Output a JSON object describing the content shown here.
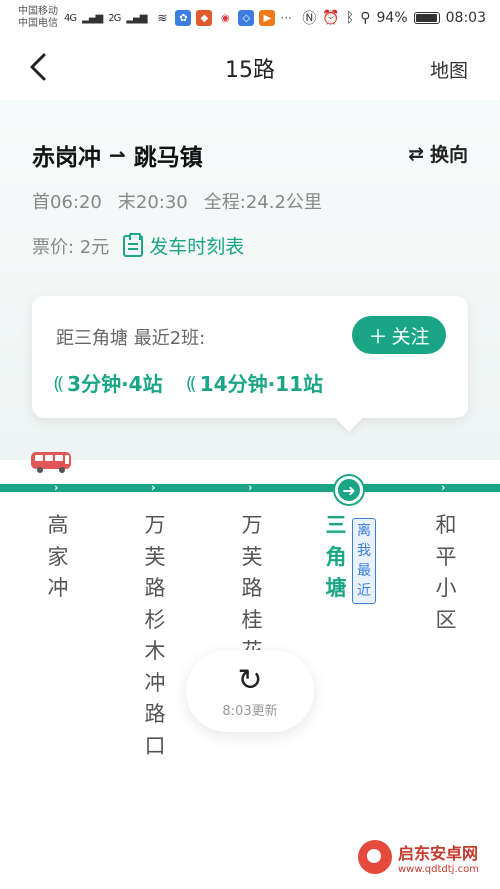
{
  "status_bar": {
    "carrier_1": "中国移动",
    "carrier_2": "中国电信",
    "signal_1": "4G",
    "signal_2": "2G",
    "battery_percent": "94%",
    "time": "08:03"
  },
  "nav": {
    "back_icon": "chevron-left-icon",
    "title": "15路",
    "map_label": "地图"
  },
  "route": {
    "from": "赤岗冲",
    "to": "跳马镇",
    "swap_label": "换向",
    "first_bus": "首06:20",
    "last_bus": "末20:30",
    "distance": "全程:24.2公里",
    "fare": "票价: 2元",
    "schedule_label": "发车时刻表"
  },
  "arrival": {
    "label": "距三角塘 最近2班:",
    "follow_label": "关注",
    "buses": [
      {
        "text": "3分钟·4站"
      },
      {
        "text": "14分钟·11站"
      }
    ]
  },
  "stations": [
    {
      "name": "高家冲"
    },
    {
      "name": "万芙路杉木冲路口"
    },
    {
      "name": "万芙路桂花路口"
    },
    {
      "name": "三角塘"
    },
    {
      "name": "和平小区"
    }
  ],
  "near_tag": "离我最近",
  "refresh": {
    "time_text": "8:03更新"
  },
  "watermark": {
    "name": "启东安卓网",
    "url": "www.qdtdtj.com"
  },
  "colors": {
    "accent": "#1aa686",
    "near_tag": "#3d7fd8",
    "bus": "#e05555"
  }
}
